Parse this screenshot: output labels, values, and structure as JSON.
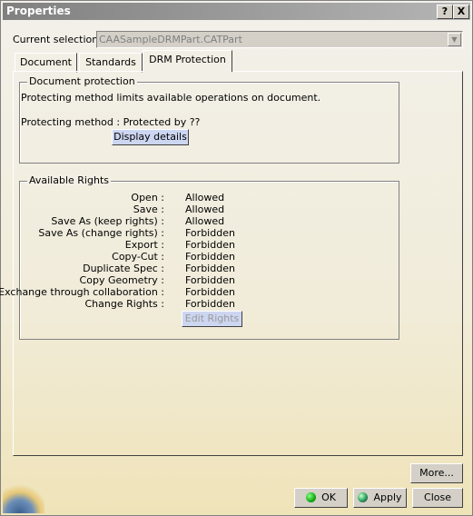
{
  "window": {
    "title": "Properties",
    "help_label": "?",
    "close_label": "X"
  },
  "selection": {
    "label": "Current selection :",
    "value": "CAASampleDRMPart.CATPart",
    "arrow": "▼"
  },
  "tabs": [
    {
      "label": "Document"
    },
    {
      "label": "Standards"
    },
    {
      "label": "DRM Protection",
      "active": true
    }
  ],
  "doc_protection": {
    "title": "Document protection",
    "description": "Protecting method limits available operations on document.",
    "method": "Protecting method : Protected by ??",
    "details_button": "Display details"
  },
  "rights": {
    "title": "Available Rights",
    "items": [
      {
        "name": "Open :",
        "value": "Allowed"
      },
      {
        "name": "Save :",
        "value": "Allowed"
      },
      {
        "name": "Save As (keep rights) :",
        "value": "Allowed"
      },
      {
        "name": "Save As (change rights) :",
        "value": "Forbidden"
      },
      {
        "name": "Export :",
        "value": "Forbidden"
      },
      {
        "name": "Copy-Cut :",
        "value": "Forbidden"
      },
      {
        "name": "Duplicate Spec :",
        "value": "Forbidden"
      },
      {
        "name": "Copy Geometry :",
        "value": "Forbidden"
      },
      {
        "name": "Exchange through collaboration :",
        "value": "Forbidden"
      },
      {
        "name": "Change Rights :",
        "value": "Forbidden"
      }
    ],
    "edit_button": "Edit Rights"
  },
  "buttons": {
    "more": "More...",
    "ok": "OK",
    "apply": "Apply",
    "close": "Close"
  },
  "colors": {
    "ok_icon": "#22aa22",
    "apply_icon": "#2a7a3a",
    "title_bar": "#808080"
  }
}
